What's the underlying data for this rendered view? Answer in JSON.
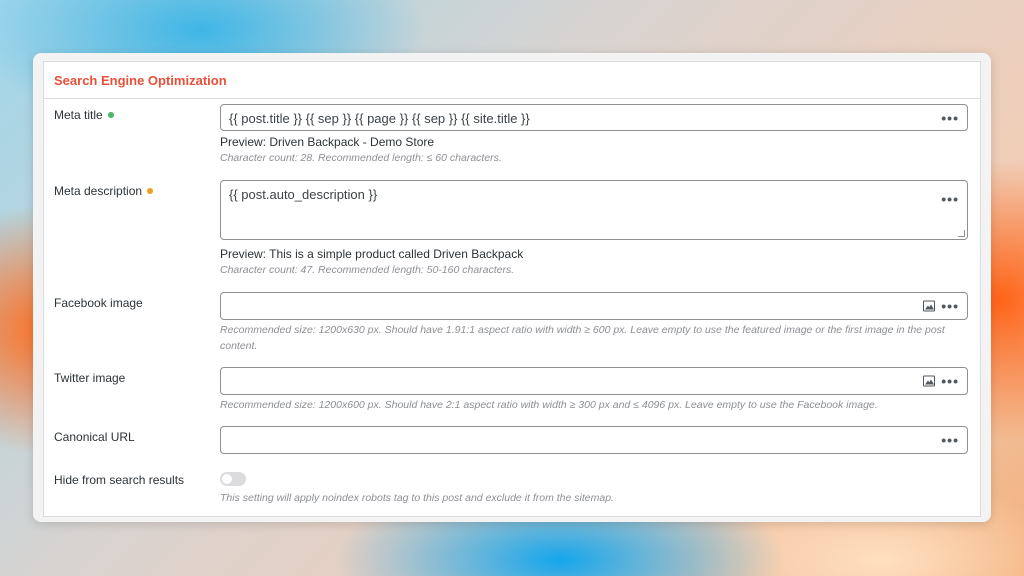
{
  "panel": {
    "title": "Search Engine Optimization"
  },
  "meta_title": {
    "label": "Meta title",
    "status_color": "#4ab866",
    "value": "{{ post.title }} {{ sep }} {{ page }} {{ sep }} {{ site.title }}",
    "preview": "Preview: Driven Backpack - Demo Store",
    "hint": "Character count: 28. Recommended length: ≤ 60 characters."
  },
  "meta_description": {
    "label": "Meta description",
    "status_color": "#f0a11a",
    "value": "{{ post.auto_description }}",
    "preview": "Preview: This is a simple product called Driven Backpack",
    "hint": "Character count: 47. Recommended length: 50-160 characters."
  },
  "facebook_image": {
    "label": "Facebook image",
    "value": "",
    "hint": "Recommended size: 1200x630 px. Should have 1.91:1 aspect ratio with width ≥ 600 px. Leave empty to use the featured image or the first image in the post content."
  },
  "twitter_image": {
    "label": "Twitter image",
    "value": "",
    "hint": "Recommended size: 1200x600 px. Should have 2:1 aspect ratio with width ≥ 300 px and ≤ 4096 px. Leave empty to use the Facebook image."
  },
  "canonical_url": {
    "label": "Canonical URL",
    "value": ""
  },
  "hide_from_search": {
    "label": "Hide from search results",
    "enabled": false,
    "hint": "This setting will apply noindex robots tag to this post and exclude it from the sitemap."
  },
  "icons": {
    "more": "more-horizontal-icon",
    "image": "image-icon"
  }
}
